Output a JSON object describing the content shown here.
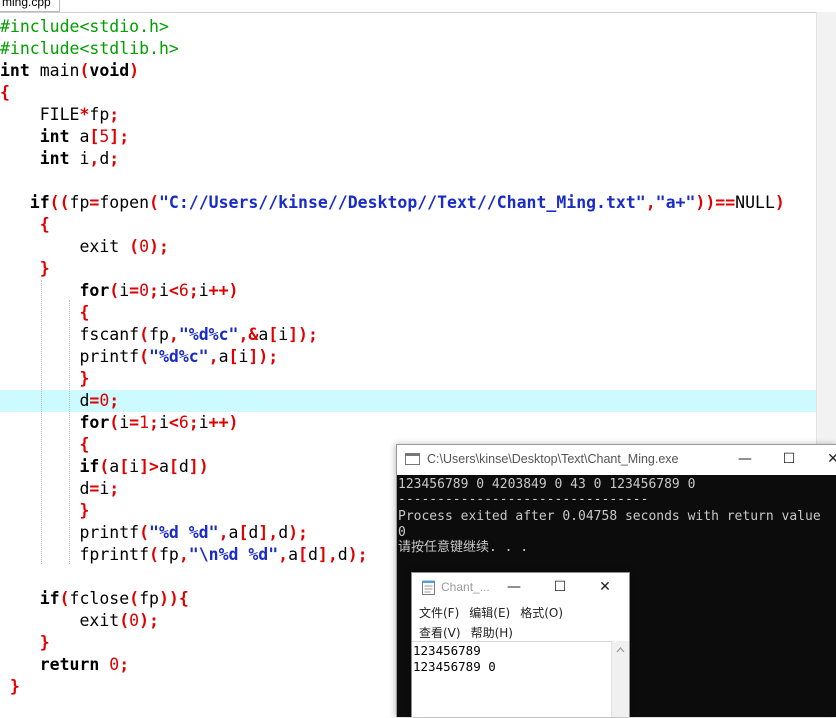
{
  "editor": {
    "tab_label": "ming.cpp",
    "lines": [
      [
        [
          "pp",
          "#include<stdio.h>"
        ]
      ],
      [
        [
          "pp",
          "#include<stdlib.h>"
        ]
      ],
      [
        [
          "kw",
          "int"
        ],
        [
          "id",
          " main"
        ],
        [
          "op",
          "("
        ],
        [
          "kw",
          "void"
        ],
        [
          "op",
          ")"
        ]
      ],
      [
        [
          "op",
          "{"
        ]
      ],
      [
        [
          "id",
          "    FILE"
        ],
        [
          "op",
          "*"
        ],
        [
          "id",
          "fp"
        ],
        [
          "op",
          ";"
        ]
      ],
      [
        [
          "kw",
          "    int"
        ],
        [
          "id",
          " a"
        ],
        [
          "op",
          "["
        ],
        [
          "num",
          "5"
        ],
        [
          "op",
          "];"
        ]
      ],
      [
        [
          "kw",
          "    int"
        ],
        [
          "id",
          " i"
        ],
        [
          "op",
          ","
        ],
        [
          "id",
          "d"
        ],
        [
          "op",
          ";"
        ]
      ],
      [],
      [
        [
          "kw",
          "   if"
        ],
        [
          "op",
          "(("
        ],
        [
          "id",
          "fp"
        ],
        [
          "op",
          "="
        ],
        [
          "id",
          "fopen"
        ],
        [
          "op",
          "("
        ],
        [
          "str",
          "\"C://Users//kinse//Desktop//Text//Chant_Ming.txt\""
        ],
        [
          "op",
          ","
        ],
        [
          "str",
          "\"a+\""
        ],
        [
          "op",
          "))=="
        ],
        [
          "id",
          "NULL"
        ],
        [
          "op",
          ")"
        ]
      ],
      [
        [
          "op",
          "    {"
        ]
      ],
      [
        [
          "id",
          "        exit "
        ],
        [
          "op",
          "("
        ],
        [
          "num",
          "0"
        ],
        [
          "op",
          ");"
        ]
      ],
      [
        [
          "op",
          "    }"
        ]
      ],
      [
        [
          "kw",
          "        for"
        ],
        [
          "op",
          "("
        ],
        [
          "id",
          "i"
        ],
        [
          "op",
          "="
        ],
        [
          "num",
          "0"
        ],
        [
          "op",
          ";"
        ],
        [
          "id",
          "i"
        ],
        [
          "op",
          "<"
        ],
        [
          "num",
          "6"
        ],
        [
          "op",
          ";"
        ],
        [
          "id",
          "i"
        ],
        [
          "op",
          "++)"
        ]
      ],
      [
        [
          "op",
          "        {"
        ]
      ],
      [
        [
          "id",
          "        fscanf"
        ],
        [
          "op",
          "("
        ],
        [
          "id",
          "fp"
        ],
        [
          "op",
          ","
        ],
        [
          "str",
          "\"%d%c\""
        ],
        [
          "op",
          ",&"
        ],
        [
          "id",
          "a"
        ],
        [
          "op",
          "["
        ],
        [
          "id",
          "i"
        ],
        [
          "op",
          "]);"
        ]
      ],
      [
        [
          "id",
          "        printf"
        ],
        [
          "op",
          "("
        ],
        [
          "str",
          "\"%d%c\""
        ],
        [
          "op",
          ","
        ],
        [
          "id",
          "a"
        ],
        [
          "op",
          "["
        ],
        [
          "id",
          "i"
        ],
        [
          "op",
          "]);"
        ]
      ],
      [
        [
          "op",
          "        }"
        ]
      ],
      [
        [
          "id",
          "        d"
        ],
        [
          "op",
          "="
        ],
        [
          "num",
          "0"
        ],
        [
          "op",
          ";"
        ]
      ],
      [
        [
          "kw",
          "        for"
        ],
        [
          "op",
          "("
        ],
        [
          "id",
          "i"
        ],
        [
          "op",
          "="
        ],
        [
          "num",
          "1"
        ],
        [
          "op",
          ";"
        ],
        [
          "id",
          "i"
        ],
        [
          "op",
          "<"
        ],
        [
          "num",
          "6"
        ],
        [
          "op",
          ";"
        ],
        [
          "id",
          "i"
        ],
        [
          "op",
          "++)"
        ]
      ],
      [
        [
          "op",
          "        {"
        ]
      ],
      [
        [
          "kw",
          "        if"
        ],
        [
          "op",
          "("
        ],
        [
          "id",
          "a"
        ],
        [
          "op",
          "["
        ],
        [
          "id",
          "i"
        ],
        [
          "op",
          "]>"
        ],
        [
          "id",
          "a"
        ],
        [
          "op",
          "["
        ],
        [
          "id",
          "d"
        ],
        [
          "op",
          "])"
        ]
      ],
      [
        [
          "id",
          "        d"
        ],
        [
          "op",
          "="
        ],
        [
          "id",
          "i"
        ],
        [
          "op",
          ";"
        ]
      ],
      [
        [
          "op",
          "        }"
        ]
      ],
      [
        [
          "id",
          "        printf"
        ],
        [
          "op",
          "("
        ],
        [
          "str",
          "\"%d %d\""
        ],
        [
          "op",
          ","
        ],
        [
          "id",
          "a"
        ],
        [
          "op",
          "["
        ],
        [
          "id",
          "d"
        ],
        [
          "op",
          "],"
        ],
        [
          "id",
          "d"
        ],
        [
          "op",
          ");"
        ]
      ],
      [
        [
          "id",
          "        fprintf"
        ],
        [
          "op",
          "("
        ],
        [
          "id",
          "fp"
        ],
        [
          "op",
          ","
        ],
        [
          "str",
          "\"\\n%d %d\""
        ],
        [
          "op",
          ","
        ],
        [
          "id",
          "a"
        ],
        [
          "op",
          "["
        ],
        [
          "id",
          "d"
        ],
        [
          "op",
          "],"
        ],
        [
          "id",
          "d"
        ],
        [
          "op",
          ");"
        ]
      ],
      [],
      [
        [
          "kw",
          "    if"
        ],
        [
          "op",
          "("
        ],
        [
          "id",
          "fclose"
        ],
        [
          "op",
          "("
        ],
        [
          "id",
          "fp"
        ],
        [
          "op",
          ")){"
        ]
      ],
      [
        [
          "id",
          "        exit"
        ],
        [
          "op",
          "("
        ],
        [
          "num",
          "0"
        ],
        [
          "op",
          ");"
        ]
      ],
      [
        [
          "op",
          "    }"
        ]
      ],
      [
        [
          "kw",
          "    return"
        ],
        [
          "num",
          " 0"
        ],
        [
          "op",
          ";"
        ]
      ],
      [
        [
          "op",
          " }"
        ]
      ]
    ]
  },
  "console": {
    "title": "C:\\Users\\kinse\\Desktop\\Text\\Chant_Ming.exe",
    "minimize_glyph": "—",
    "maximize_glyph": "☐",
    "close_glyph": "✕",
    "lines": [
      "123456789 0 4203849 0 43 0 123456789 0",
      "--------------------------------",
      "Process exited after 0.04758 seconds with return value",
      "0",
      "请按任意键继续. . ."
    ]
  },
  "notepad": {
    "title": "Chant_...",
    "minimize_glyph": "—",
    "maximize_glyph": "☐",
    "close_glyph": "✕",
    "menu_row1": [
      "文件(F)",
      "编辑(E)",
      "格式(O)"
    ],
    "menu_row2": [
      "查看(V)",
      "帮助(H)"
    ],
    "content_lines": [
      "123456789",
      "123456789 0"
    ]
  }
}
